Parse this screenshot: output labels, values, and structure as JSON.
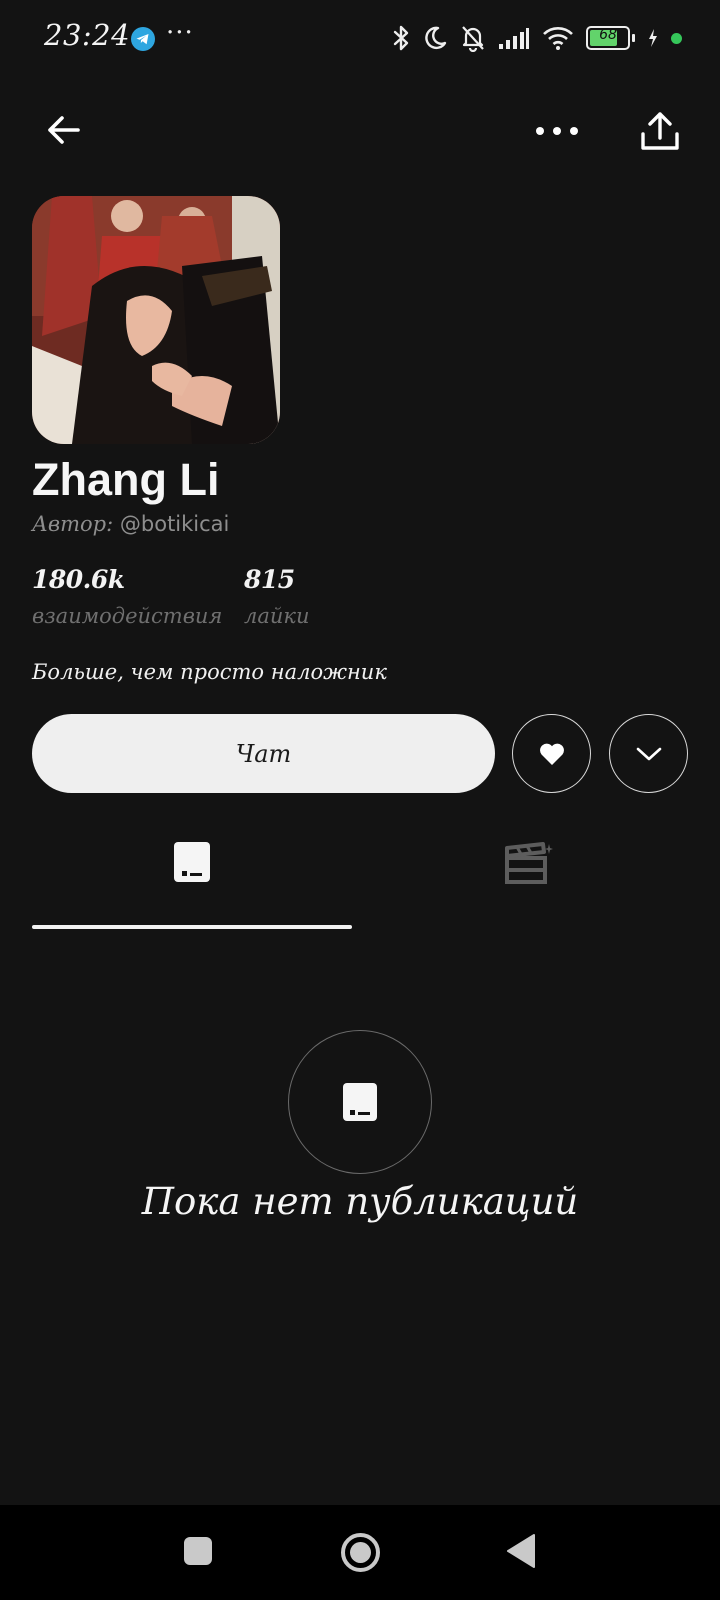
{
  "status_bar": {
    "time": "23:24",
    "dots": "···",
    "battery_level": "68",
    "icons": [
      "telegram-icon",
      "bluetooth-icon",
      "moon-icon",
      "bell-off-icon",
      "signal-icon",
      "wifi-icon",
      "battery-icon",
      "charging-icon",
      "dot-indicator"
    ]
  },
  "header": {
    "back_icon": "arrow-left-icon",
    "more_icon": "more-horizontal-icon",
    "share_icon": "share-icon"
  },
  "profile": {
    "name": "Zhang Li",
    "author_label": "Автор:",
    "author_handle": "@botikicai",
    "stats": [
      {
        "value": "180.6k",
        "label": "взаимодействия"
      },
      {
        "value": "815",
        "label": "лайки"
      }
    ],
    "description": "Больше, чем просто наложник"
  },
  "actions": {
    "chat_label": "Чат",
    "like_icon": "heart-icon",
    "expand_icon": "chevron-down-icon"
  },
  "tabs": [
    {
      "icon": "posts-icon",
      "active": true
    },
    {
      "icon": "clapperboard-icon",
      "active": false
    }
  ],
  "empty_state": {
    "icon": "posts-icon",
    "text": "Пока нет публикаций"
  },
  "nav": {
    "recent_icon": "square-icon",
    "home_icon": "circle-home-icon",
    "back_icon": "triangle-back-icon"
  },
  "colors": {
    "background": "#131313",
    "button_light": "#efefef",
    "muted_text": "#8e8e8e",
    "accent_green": "#35c75a",
    "telegram_blue": "#2ea6e0"
  }
}
